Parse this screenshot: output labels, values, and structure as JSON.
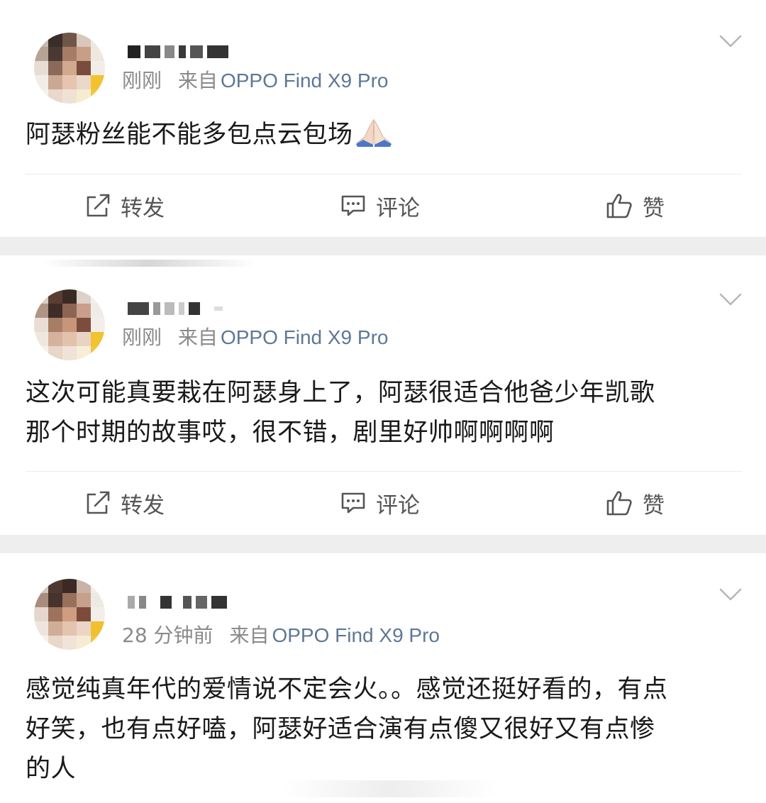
{
  "posts": [
    {
      "time": "刚刚",
      "source": "来自",
      "device": "OPPO Find X9 Pro",
      "content_lines": [
        "阿瑟粉丝能不能多包点云包场"
      ],
      "emoji": "folded-hands-icon"
    },
    {
      "time": "刚刚",
      "source": "来自",
      "device": "OPPO Find X9 Pro",
      "content_lines": [
        "这次可能真要栽在阿瑟身上了，阿瑟很适合他爸少年凯歌",
        "那个时期的故事哎，很不错，剧里好帅啊啊啊啊"
      ]
    },
    {
      "time": "28 分钟前",
      "source": "来自",
      "device": "OPPO Find X9 Pro",
      "content_lines": [
        "感觉纯真年代的爱情说不定会火。。感觉还挺好看的，有点",
        "好笑，也有点好嗑，阿瑟好适合演有点傻又很好又有点惨",
        "的人"
      ]
    }
  ],
  "actions": {
    "repost": "转发",
    "comment": "评论",
    "like": "赞"
  },
  "colors": {
    "background": "#ffffff",
    "separator": "#eeeeee",
    "meta_text": "#8a8a8a",
    "device_link": "#5d7895",
    "action_text": "#555555"
  }
}
